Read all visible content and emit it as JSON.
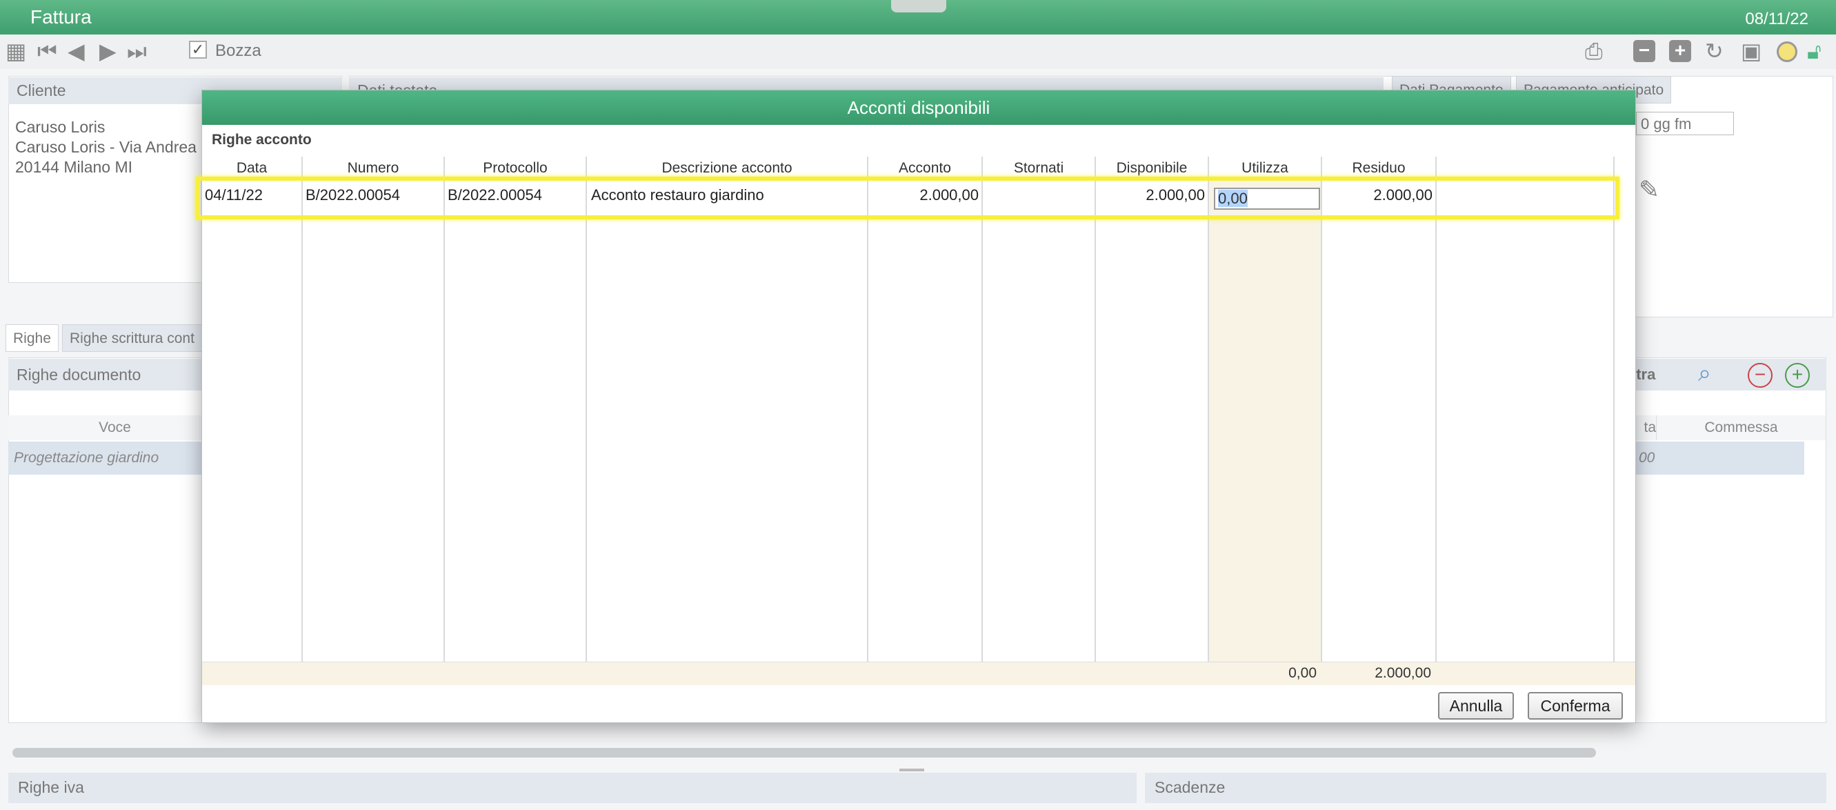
{
  "window": {
    "title": "Fattura",
    "date": "08/11/22"
  },
  "toolbar": {
    "bozza_label": "Bozza",
    "bozza_checked": true
  },
  "cliente": {
    "header": "Cliente",
    "lines": [
      "Caruso Loris",
      "Caruso Loris - Via Andrea",
      "20144 Milano MI"
    ]
  },
  "background": {
    "dati_testata": "Dati testata",
    "tab_dati_pagamento": "Dati Pagamento",
    "tab_pagamento_anticipato": "Pagamento anticipato",
    "gg_fm": "0 gg fm",
    "tabs": [
      "Righe",
      "Righe scrittura cont"
    ],
    "righe_documento": "Righe documento",
    "extra": "xtra",
    "col_voce": "Voce",
    "col_ta": "ta",
    "col_commessa": "Commessa",
    "row_voce": "Progettazione giardino",
    "row_partial": "00",
    "righe_iva": "Righe iva",
    "scadenze": "Scadenze"
  },
  "modal": {
    "title": "Acconti disponibili",
    "section": "Righe acconto",
    "columns": [
      "Data",
      "Numero",
      "Protocollo",
      "Descrizione acconto",
      "Acconto",
      "Stornati",
      "Disponibile",
      "Utilizza",
      "Residuo"
    ],
    "rows": [
      {
        "data": "04/11/22",
        "numero": "B/2022.00054",
        "protocollo": "B/2022.00054",
        "descrizione": "Acconto restauro giardino",
        "acconto": "2.000,00",
        "stornati": "",
        "disponibile": "2.000,00",
        "utilizza": "0,00",
        "residuo": "2.000,00"
      }
    ],
    "totals": {
      "utilizza": "0,00",
      "residuo": "2.000,00"
    },
    "buttons": {
      "annulla": "Annulla",
      "conferma": "Conferma"
    }
  },
  "colors": {
    "title_green": "#3f9f6f",
    "highlight": "#f7ef3c",
    "utilizza_bg": "#f8f3e5"
  }
}
